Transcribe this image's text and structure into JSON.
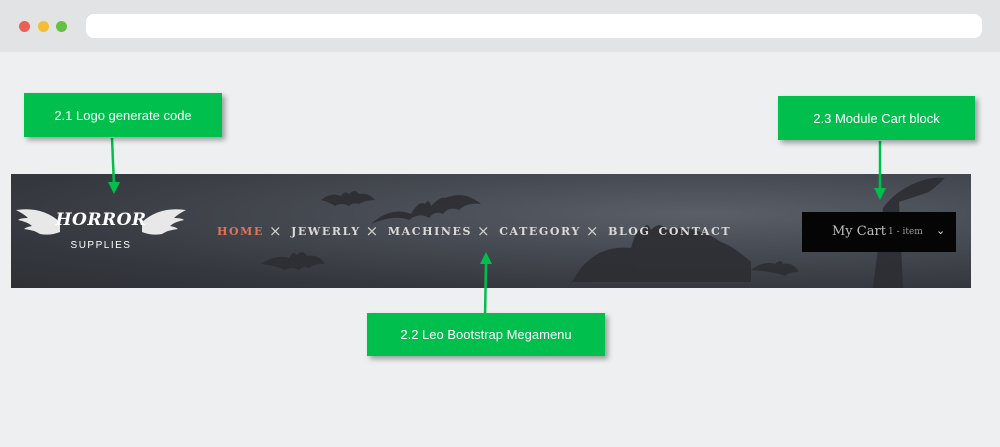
{
  "logo": {
    "title": "HORROR",
    "subtitle": "SUPPLIES"
  },
  "menu": {
    "items": [
      {
        "label": "HOME",
        "has_dropdown": true,
        "active": true
      },
      {
        "label": "JEWERLY",
        "has_dropdown": true
      },
      {
        "label": "MACHINES",
        "has_dropdown": true
      },
      {
        "label": "CATEGORY",
        "has_dropdown": true
      },
      {
        "label": "BLOG",
        "has_dropdown": false
      },
      {
        "label": "CONTACT",
        "has_dropdown": false
      }
    ],
    "dropdown_glyph": "×"
  },
  "cart": {
    "label": "My Cart",
    "count": "1 - item",
    "caret": "⌄"
  },
  "annotations": {
    "logo": "2.1 Logo generate code",
    "megamenu": "2.2 Leo Bootstrap Megamenu",
    "cart": "2.3 Module Cart block"
  },
  "colors": {
    "callout": "#00bf4d",
    "active_menu": "#e0735a",
    "banner": "#3a3d43",
    "cart_bg": "#050505"
  }
}
